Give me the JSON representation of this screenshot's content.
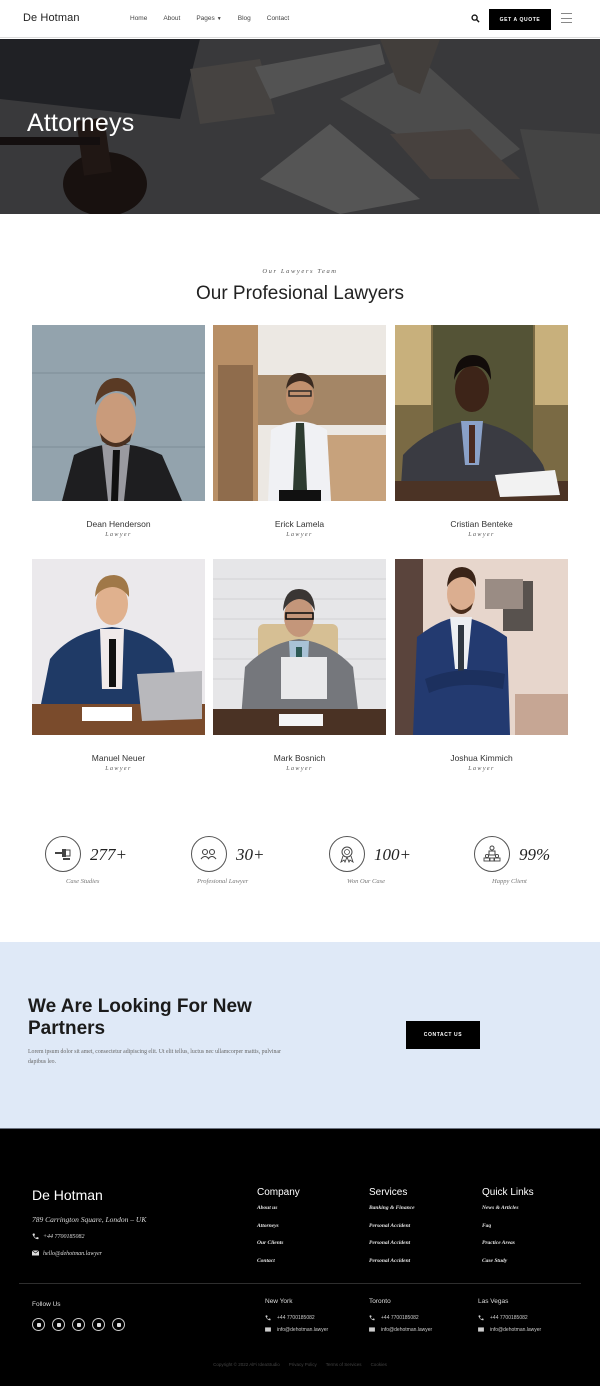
{
  "header": {
    "logo": "De Hotman",
    "nav": [
      {
        "label": "Home"
      },
      {
        "label": "About"
      },
      {
        "label": "Pages",
        "has_dropdown": true
      },
      {
        "label": "Blog"
      },
      {
        "label": "Contact"
      }
    ],
    "search_icon": "search-icon",
    "quote_button": "GET A QUOTE",
    "menu_icon": "hamburger-icon"
  },
  "hero": {
    "title": "Attorneys"
  },
  "team": {
    "eyebrow": "Our Lawyers Team",
    "title": "Our Profesional Lawyers",
    "lawyers": [
      {
        "name": "Dean Henderson",
        "role": "Lawyer"
      },
      {
        "name": "Erick Lamela",
        "role": "Lawyer"
      },
      {
        "name": "Cristian Benteke",
        "role": "Lawyer"
      },
      {
        "name": "Manuel Neuer",
        "role": "Lawyer"
      },
      {
        "name": "Mark Bosnich",
        "role": "Lawyer"
      },
      {
        "name": "Joshua Kimmich",
        "role": "Lawyer"
      }
    ]
  },
  "stats": [
    {
      "icon": "gavel-icon",
      "value": "277+",
      "label": "Case Studies"
    },
    {
      "icon": "users-icon",
      "value": "30+",
      "label": "Profesional Lawyer"
    },
    {
      "icon": "award-icon",
      "value": "100+",
      "label": "Won Our Case"
    },
    {
      "icon": "team-hierarchy-icon",
      "value": "99%",
      "label": "Happy Client"
    }
  ],
  "cta": {
    "title": "We Are Looking For New Partners",
    "text": "Lorem ipsum dolor sit amet, consectetur adipiscing elit. Ut elit tellus, luctus nec ullamcorper mattis, pulvinar dapibus leo.",
    "button": "CONTACT US",
    "background": "#dfe9f7"
  },
  "footer": {
    "logo": "De Hotman",
    "address": "789 Carrington Square, London – UK",
    "phone": "+44 7700185082",
    "email": "hello@dehotman.lawyer",
    "columns": [
      {
        "title": "Company",
        "links": [
          "About us",
          "Attorneys",
          "Our Clients",
          "Contact"
        ]
      },
      {
        "title": "Services",
        "links": [
          "Banking & Finance",
          "Personal Accident",
          "Personal Accident",
          "Personal Accident"
        ]
      },
      {
        "title": "Quick Links",
        "links": [
          "News & Articles",
          "Faq",
          "Practice Areas",
          "Case Study"
        ]
      }
    ],
    "follow_label": "Follow Us",
    "socials": [
      "facebook-icon",
      "twitter-icon",
      "youtube-icon",
      "youtube-alt-icon",
      "instagram-icon"
    ],
    "offices": [
      {
        "city": "New York",
        "phone": "+44 7700185082",
        "email": "info@dehotman.lawyer"
      },
      {
        "city": "Toronto",
        "phone": "+44 7700185082",
        "email": "info@dehotman.lawyer"
      },
      {
        "city": "Las Vegas",
        "phone": "+44 7700185082",
        "email": "info@dehotman.lawyer"
      }
    ],
    "copyright": "Copyright © 2022 AlFi IdeaStudio",
    "legal_links": [
      "Privacy Policy",
      "Terms of Services",
      "Cookies"
    ]
  }
}
